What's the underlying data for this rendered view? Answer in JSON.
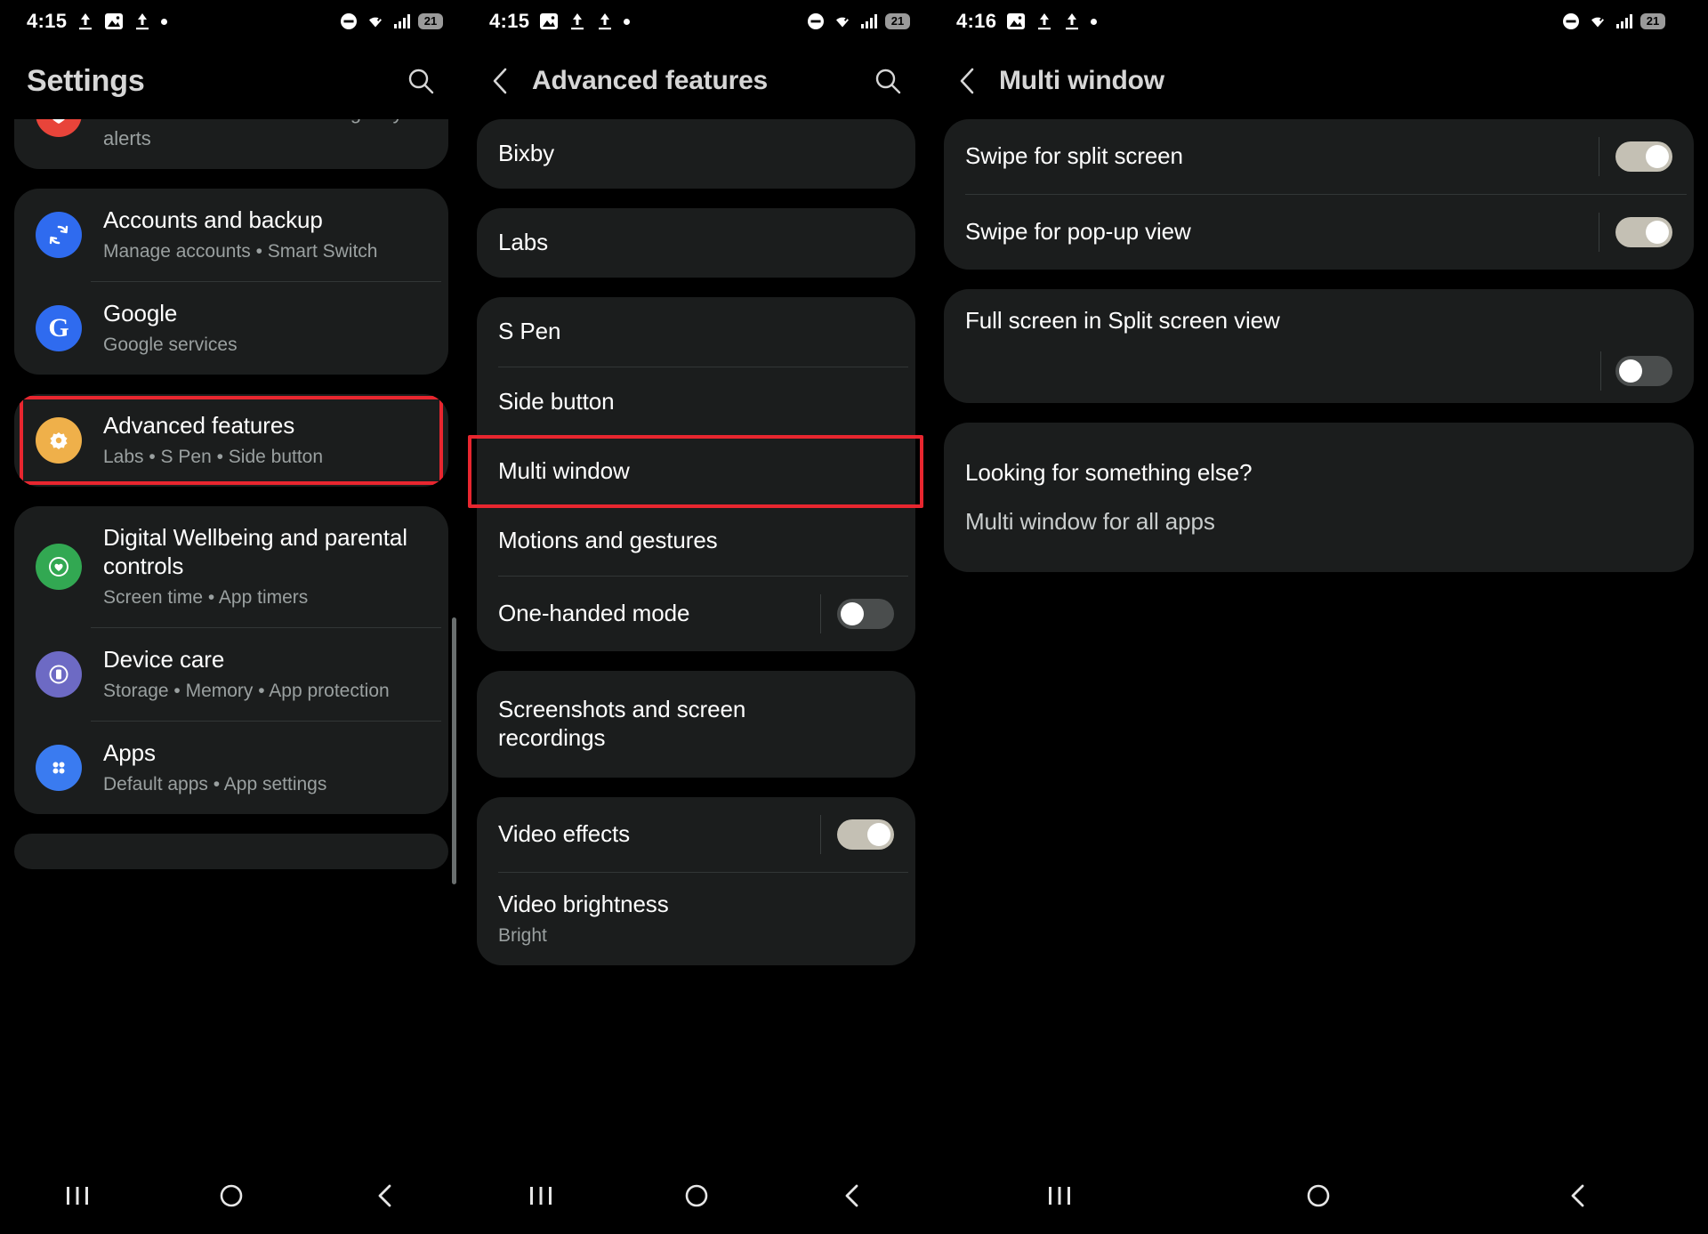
{
  "panels": [
    {
      "id": "settings",
      "status": {
        "time": "4:15",
        "battery": "21"
      },
      "header": {
        "title": "Settings",
        "search_icon": "search-icon"
      },
      "groups": [
        {
          "partial_top": true,
          "rows": [
            {
              "title": "",
              "subtitle": "Medical info  •  Wireless emergency alerts",
              "icon_color": "#e8443a",
              "icon": "safety-icon"
            }
          ]
        },
        {
          "rows": [
            {
              "title": "Accounts and backup",
              "subtitle": "Manage accounts  •  Smart Switch",
              "icon_color": "#2f6bef",
              "icon": "sync-icon"
            },
            {
              "title": "Google",
              "subtitle": "Google services",
              "icon_color": "#2f6bef",
              "icon": "google-icon"
            }
          ]
        },
        {
          "highlighted": true,
          "rows": [
            {
              "title": "Advanced features",
              "subtitle": "Labs  •  S Pen  •  Side button",
              "icon_color": "#efb04a",
              "icon": "advanced-features-icon"
            }
          ]
        },
        {
          "rows": [
            {
              "title": "Digital Wellbeing and parental controls",
              "subtitle": "Screen time  •  App timers",
              "icon_color": "#32a852",
              "icon": "wellbeing-icon"
            },
            {
              "title": "Device care",
              "subtitle": "Storage  •  Memory  •  App protection",
              "icon_color": "#6d6ac4",
              "icon": "device-care-icon"
            },
            {
              "title": "Apps",
              "subtitle": "Default apps  •  App settings",
              "icon_color": "#3a7bf0",
              "icon": "apps-icon"
            }
          ]
        }
      ],
      "nav": {
        "recents": "recents-button",
        "home": "home-button",
        "back": "back-button"
      }
    },
    {
      "id": "advanced-features",
      "status": {
        "time": "4:15",
        "battery": "21"
      },
      "header": {
        "title": "Advanced features",
        "search_icon": "search-icon",
        "back_icon": "back-chevron-icon"
      },
      "groups": [
        {
          "rows": [
            {
              "title": "Bixby"
            }
          ]
        },
        {
          "rows": [
            {
              "title": "Labs"
            }
          ]
        },
        {
          "rows": [
            {
              "title": "S Pen"
            },
            {
              "title": "Side button"
            },
            {
              "title": "Multi window",
              "highlighted": true
            },
            {
              "title": "Motions and gestures"
            },
            {
              "title": "One-handed mode",
              "toggle": "off"
            }
          ]
        },
        {
          "rows": [
            {
              "title": "Screenshots and screen recordings"
            }
          ]
        },
        {
          "rows": [
            {
              "title": "Video effects",
              "toggle": "on"
            },
            {
              "title": "Video brightness",
              "subtitle": "Bright"
            }
          ]
        }
      ],
      "nav": {
        "recents": "recents-button",
        "home": "home-button",
        "back": "back-button"
      }
    },
    {
      "id": "multi-window",
      "status": {
        "time": "4:16",
        "battery": "21"
      },
      "header": {
        "title": "Multi window",
        "back_icon": "back-chevron-icon"
      },
      "groups": [
        {
          "rows": [
            {
              "title": "Swipe for split screen",
              "toggle": "on"
            },
            {
              "title": "Swipe for pop-up view",
              "toggle": "on"
            }
          ]
        },
        {
          "rows": [
            {
              "title": "Full screen in Split screen view",
              "toggle": "off",
              "toggle_below": true
            }
          ]
        },
        {
          "rows": [
            {
              "title": "Looking for something else?",
              "heading": true
            },
            {
              "title": "Multi window for all apps",
              "muted": true
            }
          ]
        }
      ],
      "nav": {
        "recents": "recents-button",
        "home": "home-button",
        "back": "back-button"
      }
    }
  ],
  "colors": {
    "annotation": "#e8262f",
    "card_bg": "#1b1d1d",
    "page_bg": "#000000",
    "primary_text": "#ffffff",
    "secondary_text": "#9aa0a0"
  }
}
